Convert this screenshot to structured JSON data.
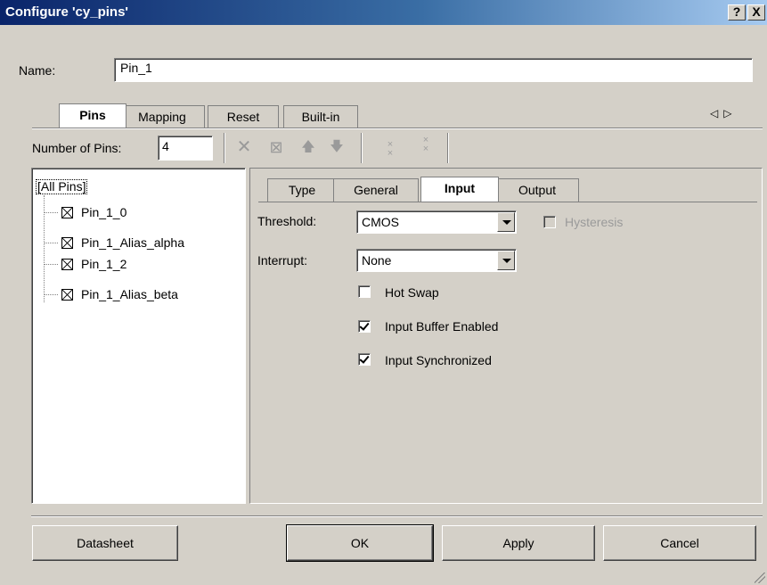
{
  "window": {
    "title": "Configure 'cy_pins'",
    "help_label": "?",
    "close_label": "X"
  },
  "name_field": {
    "label": "Name:",
    "value": "Pin_1"
  },
  "tabs": [
    {
      "label": "Pins",
      "active": true
    },
    {
      "label": "Mapping",
      "active": false
    },
    {
      "label": "Reset",
      "active": false
    },
    {
      "label": "Built-in",
      "active": false
    }
  ],
  "tab_scroll_arrows": "◁▷",
  "toolbar": {
    "num_pins_label": "Number of Pins:",
    "num_pins_value": "4",
    "delete_icon": "✕",
    "copy_icon": "⊠",
    "up_icon": "🡅",
    "down_icon": "🡇",
    "small_icon_1": "×\n×",
    "small_icon_2": "×\n×"
  },
  "tree": {
    "root": "[All Pins]",
    "items": [
      "Pin_1_0",
      "Pin_1_Alias_alpha",
      "Pin_1_2",
      "Pin_1_Alias_beta"
    ]
  },
  "inner_tabs": [
    {
      "label": "Type",
      "active": false
    },
    {
      "label": "General",
      "active": false
    },
    {
      "label": "Input",
      "active": true
    },
    {
      "label": "Output",
      "active": false
    }
  ],
  "input_settings": {
    "threshold_label": "Threshold:",
    "threshold_value": "CMOS",
    "hysteresis_label": "Hysteresis",
    "interrupt_label": "Interrupt:",
    "interrupt_value": "None",
    "hot_swap_label": "Hot Swap",
    "hot_swap_checked": false,
    "input_buffer_label": "Input Buffer Enabled",
    "input_buffer_checked": true,
    "input_sync_label": "Input Synchronized",
    "input_sync_checked": true
  },
  "buttons": {
    "datasheet": "Datasheet",
    "ok": "OK",
    "apply": "Apply",
    "cancel": "Cancel"
  }
}
